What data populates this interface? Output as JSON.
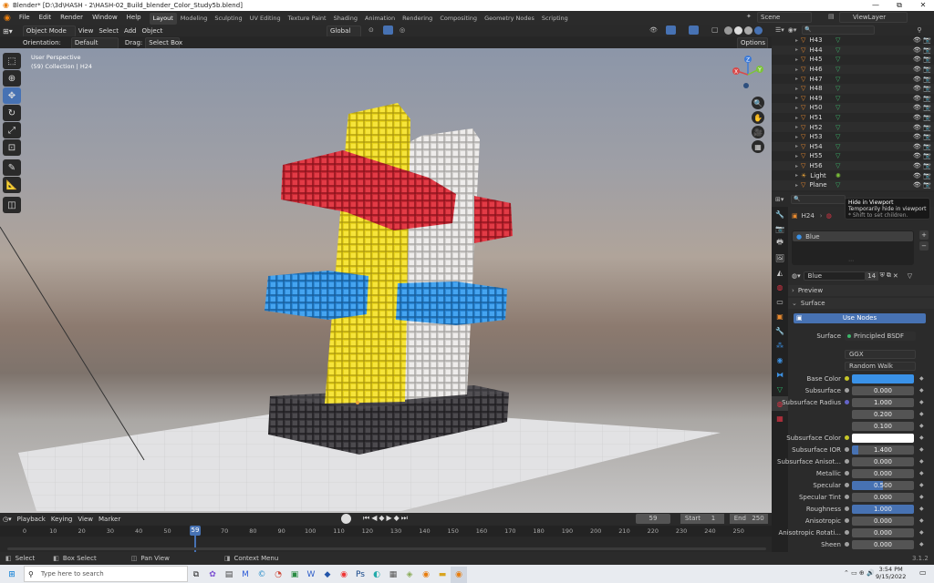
{
  "window": {
    "title": "Blender* [D:\\3d\\HASH - 2\\HASH-02_Build_blender_Color_Study5b.blend]",
    "minimize": "—",
    "maximize": "⧉",
    "close": "✕"
  },
  "menu": {
    "items": [
      "File",
      "Edit",
      "Render",
      "Window",
      "Help"
    ]
  },
  "workspaces": {
    "tabs": [
      "Layout",
      "Modeling",
      "Sculpting",
      "UV Editing",
      "Texture Paint",
      "Shading",
      "Animation",
      "Rendering",
      "Compositing",
      "Geometry Nodes",
      "Scripting"
    ],
    "active": "Layout"
  },
  "scene": {
    "label": "Scene",
    "view_layer": "ViewLayer"
  },
  "viewport_header": {
    "mode": "Object Mode",
    "menus": [
      "View",
      "Select",
      "Add",
      "Object"
    ],
    "transform_orientation": "Global",
    "options": "Options"
  },
  "viewport_header2": {
    "orientation_label": "Orientation:",
    "orientation_value": "Default",
    "drag_label": "Drag:",
    "drag_value": "Select Box"
  },
  "viewport": {
    "info_line1": "User Perspective",
    "info_line2": "(59) Collection | H24"
  },
  "gizmo": {
    "x": "X",
    "y": "Y",
    "z": "Z"
  },
  "outliner": {
    "rows": [
      {
        "name": "H43",
        "icon": "mesh"
      },
      {
        "name": "H44",
        "icon": "mesh"
      },
      {
        "name": "H45",
        "icon": "mesh"
      },
      {
        "name": "H46",
        "icon": "mesh"
      },
      {
        "name": "H47",
        "icon": "mesh"
      },
      {
        "name": "H48",
        "icon": "mesh"
      },
      {
        "name": "H49",
        "icon": "mesh"
      },
      {
        "name": "H50",
        "icon": "mesh"
      },
      {
        "name": "H51",
        "icon": "mesh"
      },
      {
        "name": "H52",
        "icon": "mesh"
      },
      {
        "name": "H53",
        "icon": "mesh"
      },
      {
        "name": "H54",
        "icon": "mesh"
      },
      {
        "name": "H55",
        "icon": "mesh"
      },
      {
        "name": "H56",
        "icon": "mesh"
      },
      {
        "name": "Light",
        "icon": "light"
      },
      {
        "name": "Plane",
        "icon": "mesh"
      }
    ]
  },
  "tooltip": {
    "title": "Hide in Viewport",
    "line1": "Temporarily hide in viewport",
    "line2": "* Shift to set children."
  },
  "properties": {
    "object_name": "H24",
    "material_slot": "Blue",
    "material_name": "Blue",
    "material_users": "14",
    "preview_label": "Preview",
    "surface_panel": "Surface",
    "use_nodes": "Use Nodes",
    "surface_label": "Surface",
    "surface_value": "Principled BSDF",
    "distribution": "GGX",
    "subsurface_method": "Random Walk",
    "fields": [
      {
        "label": "Base Color",
        "type": "color",
        "color": "#3a92e8",
        "dot": "yellow"
      },
      {
        "label": "Subsurface",
        "value": "0.000",
        "dot": "gray"
      },
      {
        "label": "Subsurface Radius",
        "value": "1.000",
        "dot": "purple"
      },
      {
        "label": "",
        "value": "0.200",
        "dot": ""
      },
      {
        "label": "",
        "value": "0.100",
        "dot": ""
      },
      {
        "label": "Subsurface Color",
        "type": "color",
        "color": "#ffffff",
        "dot": "yellow"
      },
      {
        "label": "Subsurface IOR",
        "value": "1.400",
        "dot": "gray",
        "fill": 0.1
      },
      {
        "label": "Subsurface Anisot...",
        "value": "0.000",
        "dot": "gray"
      },
      {
        "label": "Metallic",
        "value": "0.000",
        "dot": "gray"
      },
      {
        "label": "Specular",
        "value": "0.500",
        "dot": "gray",
        "fill": 0.5
      },
      {
        "label": "Specular Tint",
        "value": "0.000",
        "dot": "gray"
      },
      {
        "label": "Roughness",
        "value": "1.000",
        "dot": "gray",
        "fill": 1.0
      },
      {
        "label": "Anisotropic",
        "value": "0.000",
        "dot": "gray"
      },
      {
        "label": "Anisotropic Rotati...",
        "value": "0.000",
        "dot": "gray"
      },
      {
        "label": "Sheen",
        "value": "0.000",
        "dot": "gray"
      }
    ]
  },
  "timeline": {
    "menus": [
      "Playback",
      "Keying",
      "View",
      "Marker"
    ],
    "current_frame": "59",
    "start_label": "Start",
    "start": "1",
    "end_label": "End",
    "end": "250",
    "ticks": [
      "0",
      "10",
      "20",
      "30",
      "40",
      "50",
      "70",
      "80",
      "90",
      "100",
      "110",
      "120",
      "130",
      "140",
      "150",
      "160",
      "170",
      "180",
      "190",
      "200",
      "210",
      "220",
      "230",
      "240",
      "250"
    ]
  },
  "statusbar": {
    "select": "Select",
    "box_select": "Box Select",
    "pan_view": "Pan View",
    "context_menu": "Context Menu",
    "version": "3.1.2"
  },
  "taskbar": {
    "search_placeholder": "Type here to search",
    "time": "3:54 PM",
    "date": "9/15/2022"
  },
  "colors": {
    "accent": "#4772b3",
    "yellow": "#f2de1d",
    "red": "#d8303c",
    "blue": "#2e8fe0",
    "white": "#e6e4e2",
    "dark": "#2e2c30"
  }
}
